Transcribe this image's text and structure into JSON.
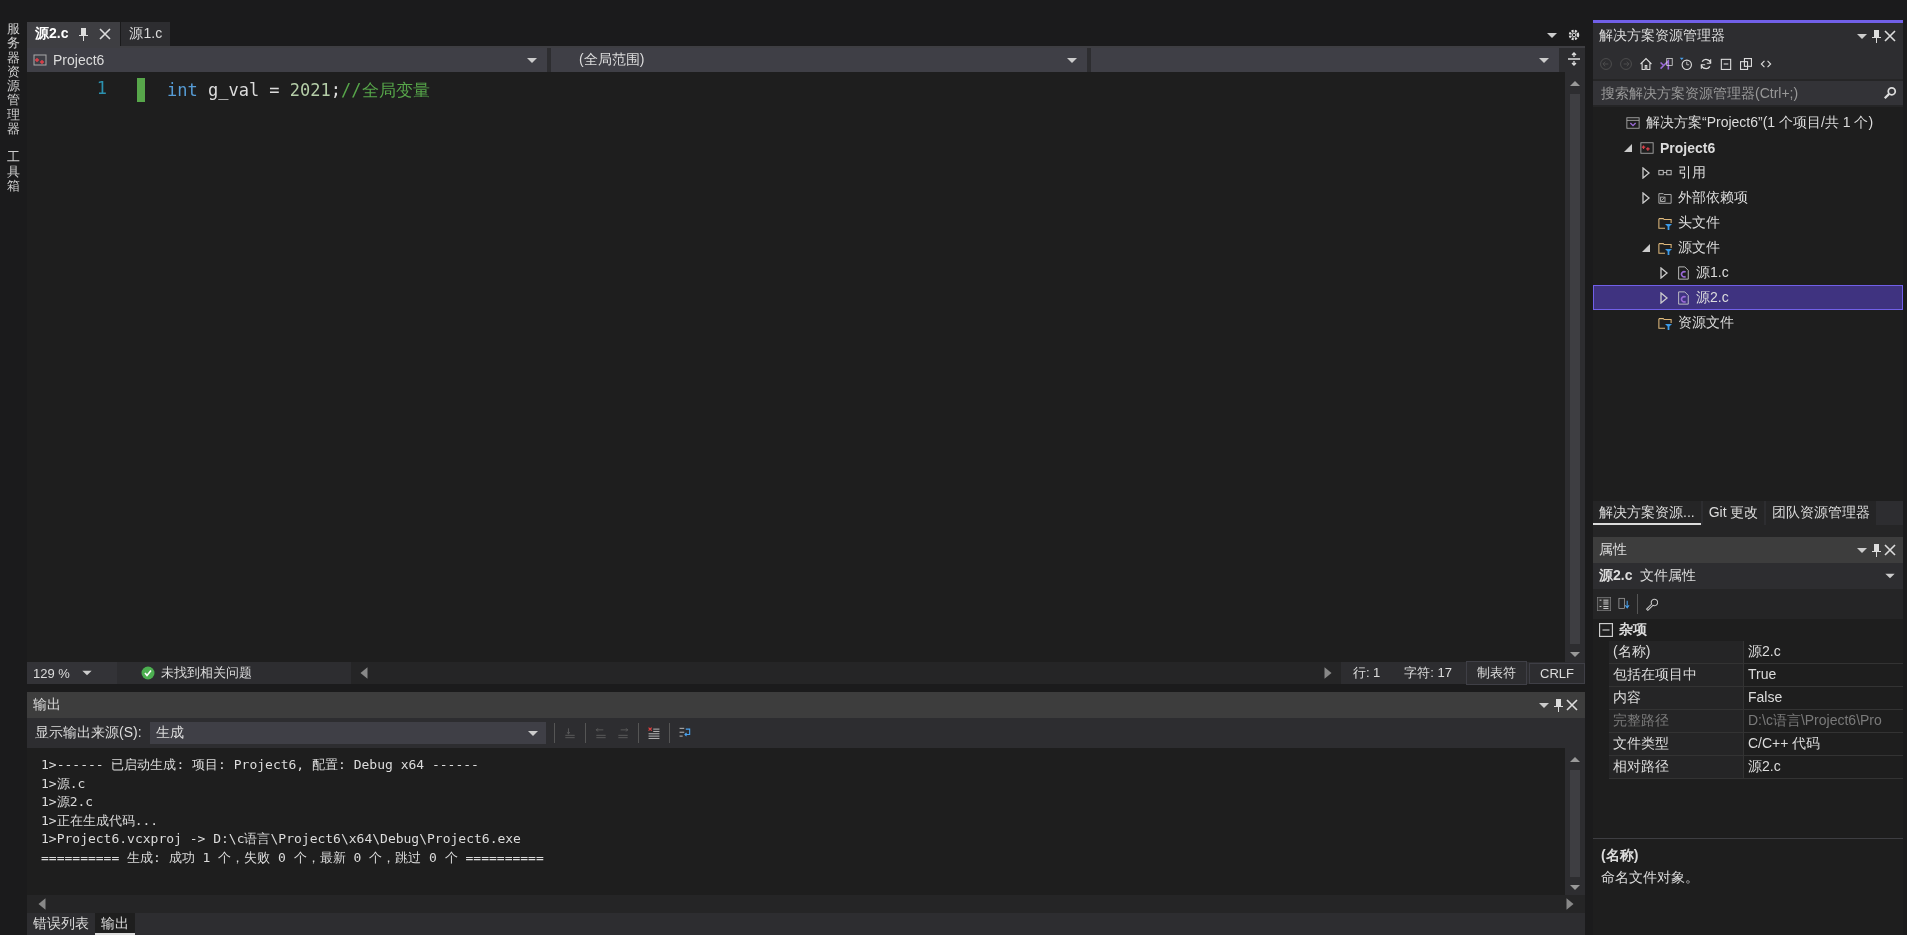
{
  "side_tabs": [
    {
      "label": "服务器资源管理器"
    },
    {
      "label": "工具箱"
    }
  ],
  "editor": {
    "tabs": [
      {
        "label": "源2.c",
        "selected": true
      },
      {
        "label": "源1.c",
        "selected": false
      }
    ],
    "nav": {
      "project": "Project6",
      "scope": "(全局范围)"
    },
    "lines": [
      {
        "number": "1",
        "changed": true,
        "tokens": [
          {
            "kind": "keyword",
            "text": "int"
          },
          {
            "kind": "plain",
            "text": " g_val = "
          },
          {
            "kind": "number",
            "text": "2021"
          },
          {
            "kind": "plain",
            "text": ";"
          },
          {
            "kind": "comment",
            "text": "//全局变量"
          }
        ]
      }
    ],
    "status": {
      "zoom": "129 %",
      "issues": "未找到相关问题",
      "line": "行: 1",
      "char": "字符: 17",
      "indent": "制表符",
      "eol": "CRLF"
    }
  },
  "output": {
    "title": "输出",
    "source_label": "显示输出来源(S):",
    "source": "生成",
    "lines": [
      "1>------ 已启动生成: 项目: Project6, 配置: Debug x64 ------",
      "1>源.c",
      "1>源2.c",
      "1>正在生成代码...",
      "1>Project6.vcxproj -> D:\\c语言\\Project6\\x64\\Debug\\Project6.exe",
      "========== 生成: 成功 1 个，失败 0 个，最新 0 个，跳过 0 个 =========="
    ],
    "tabs": [
      {
        "label": "错误列表",
        "selected": false
      },
      {
        "label": "输出",
        "selected": true
      }
    ]
  },
  "solution_explorer": {
    "title": "解决方案资源管理器",
    "search": {
      "placeholder": "搜索解决方案资源管理器(Ctrl+;)"
    },
    "tree": [
      {
        "kind": "solution",
        "label": "解决方案“Project6”(1 个项目/共 1 个)",
        "selected": false,
        "children": [
          {
            "kind": "project",
            "label": "Project6",
            "expanded": true,
            "selected": false,
            "children": [
              {
                "kind": "references",
                "label": "引用",
                "expanded": false,
                "selected": false
              },
              {
                "kind": "external",
                "label": "外部依赖项",
                "expanded": false,
                "selected": false
              },
              {
                "kind": "folder",
                "label": "头文件",
                "selected": false
              },
              {
                "kind": "folder",
                "label": "源文件",
                "expanded": true,
                "selected": false,
                "children": [
                  {
                    "kind": "file",
                    "label": "源1.c",
                    "expanded": false,
                    "selected": false
                  },
                  {
                    "kind": "file",
                    "label": "源2.c",
                    "expanded": false,
                    "selected": true
                  }
                ]
              },
              {
                "kind": "folder",
                "label": "资源文件",
                "selected": false
              }
            ]
          }
        ]
      }
    ],
    "tabs": [
      {
        "label": "解决方案资源...",
        "selected": true
      },
      {
        "label": "Git 更改",
        "selected": false
      },
      {
        "label": "团队资源管理器",
        "selected": false
      }
    ]
  },
  "properties": {
    "title": "属性",
    "object": "源2.c",
    "object_type": "文件属性",
    "category": "杂项",
    "rows": [
      {
        "name": "(名称)",
        "value": "源2.c",
        "disabled": false
      },
      {
        "name": "包括在项目中",
        "value": "True",
        "disabled": false
      },
      {
        "name": "内容",
        "value": "False",
        "disabled": false
      },
      {
        "name": "完整路径",
        "value": "D:\\c语言\\Project6\\Pro",
        "disabled": true
      },
      {
        "name": "文件类型",
        "value": "C/C++ 代码",
        "disabled": false
      },
      {
        "name": "相对路径",
        "value": "源2.c",
        "disabled": false
      }
    ],
    "description": {
      "title": "(名称)",
      "text": "命名文件对象。"
    }
  }
}
